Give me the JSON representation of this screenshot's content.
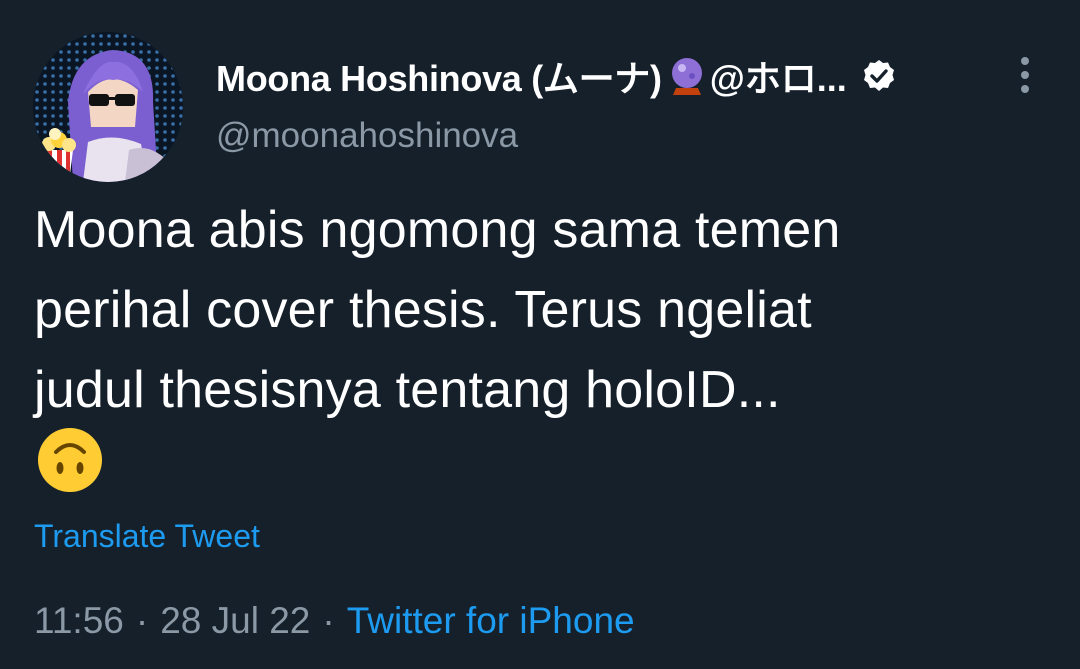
{
  "tweet": {
    "author": {
      "display_name": "Moona Hoshinova (ムーナ)",
      "name_suffix": "@ホロ...",
      "handle": "@moonahoshinova",
      "verified": true
    },
    "text_lines": [
      "Moona abis ngomong sama temen",
      "perihal cover thesis. Terus ngeliat",
      "judul thesisnya tentang holoID..."
    ],
    "emoji": "upside-down-face",
    "translate_label": "Translate Tweet",
    "time": "11:56",
    "date": "28 Jul 22",
    "separator": "·",
    "source": "Twitter for iPhone"
  },
  "icons": {
    "crystal_ball": "crystal-ball-icon",
    "verified": "verified-badge-icon",
    "more": "more-options-icon"
  },
  "colors": {
    "background": "#15202b",
    "text": "#ffffff",
    "muted": "#8b98a5",
    "link": "#1d9bf0"
  }
}
